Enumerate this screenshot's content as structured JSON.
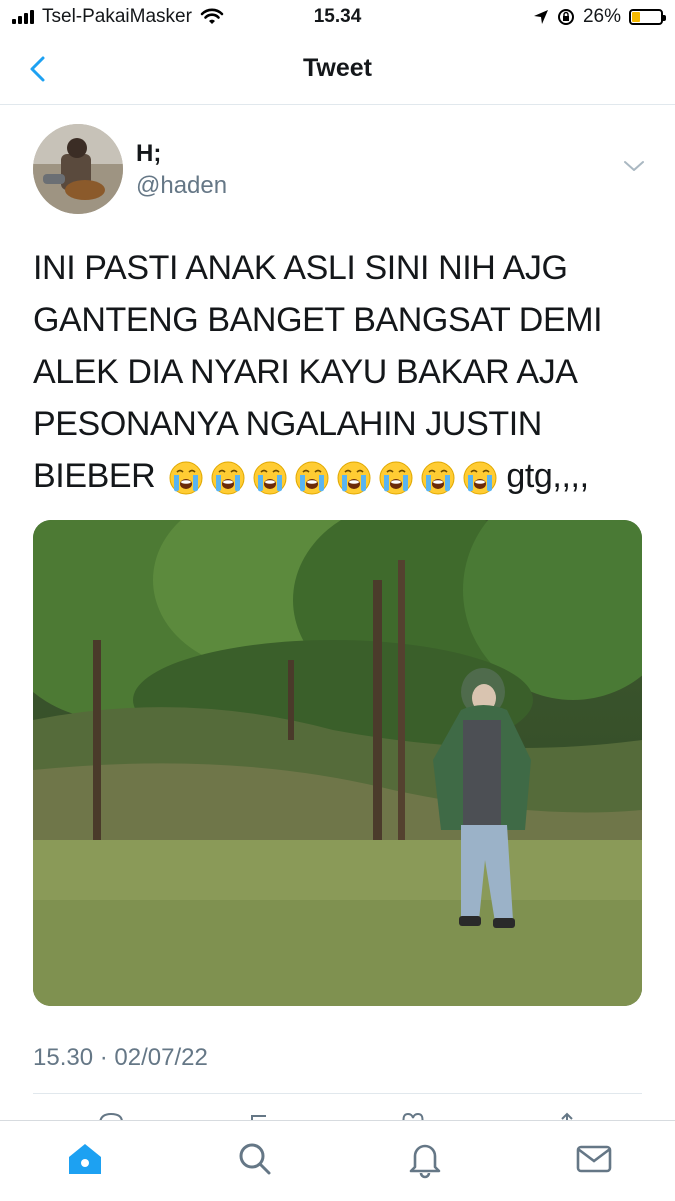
{
  "status_bar": {
    "carrier": "Tsel-PakaiMasker",
    "time": "15.34",
    "battery_percent": "26%",
    "battery_level": 0.26,
    "icons": [
      "signal-icon",
      "wifi-icon",
      "location-arrow-icon",
      "rotation-lock-icon",
      "battery-icon"
    ]
  },
  "nav": {
    "title": "Tweet",
    "back_icon": "chevron-left-icon"
  },
  "tweet": {
    "display_name": "H;",
    "handle": "@haden",
    "text": "INI PASTI ANAK ASLI SINI NIH AJG GANTENG BANGET BANGSAT DEMI ALEK DIA NYARI KAYU BAKAR AJA PESONANYA NGALAHIN JUSTIN BIEBER",
    "emoji_name": "loudly-crying-face-emoji",
    "emoji_count": 8,
    "trailing_text": "gtg,,,,",
    "timestamp": "15.30 · 02/07/22",
    "more_icon": "chevron-down-icon"
  },
  "tab_bar": {
    "tabs": [
      "home-icon",
      "search-icon",
      "notifications-icon",
      "messages-icon"
    ],
    "active": "home-icon"
  },
  "colors": {
    "accent": "#1da1f2",
    "secondary_text": "#657786",
    "divider": "#e1e8ed"
  }
}
